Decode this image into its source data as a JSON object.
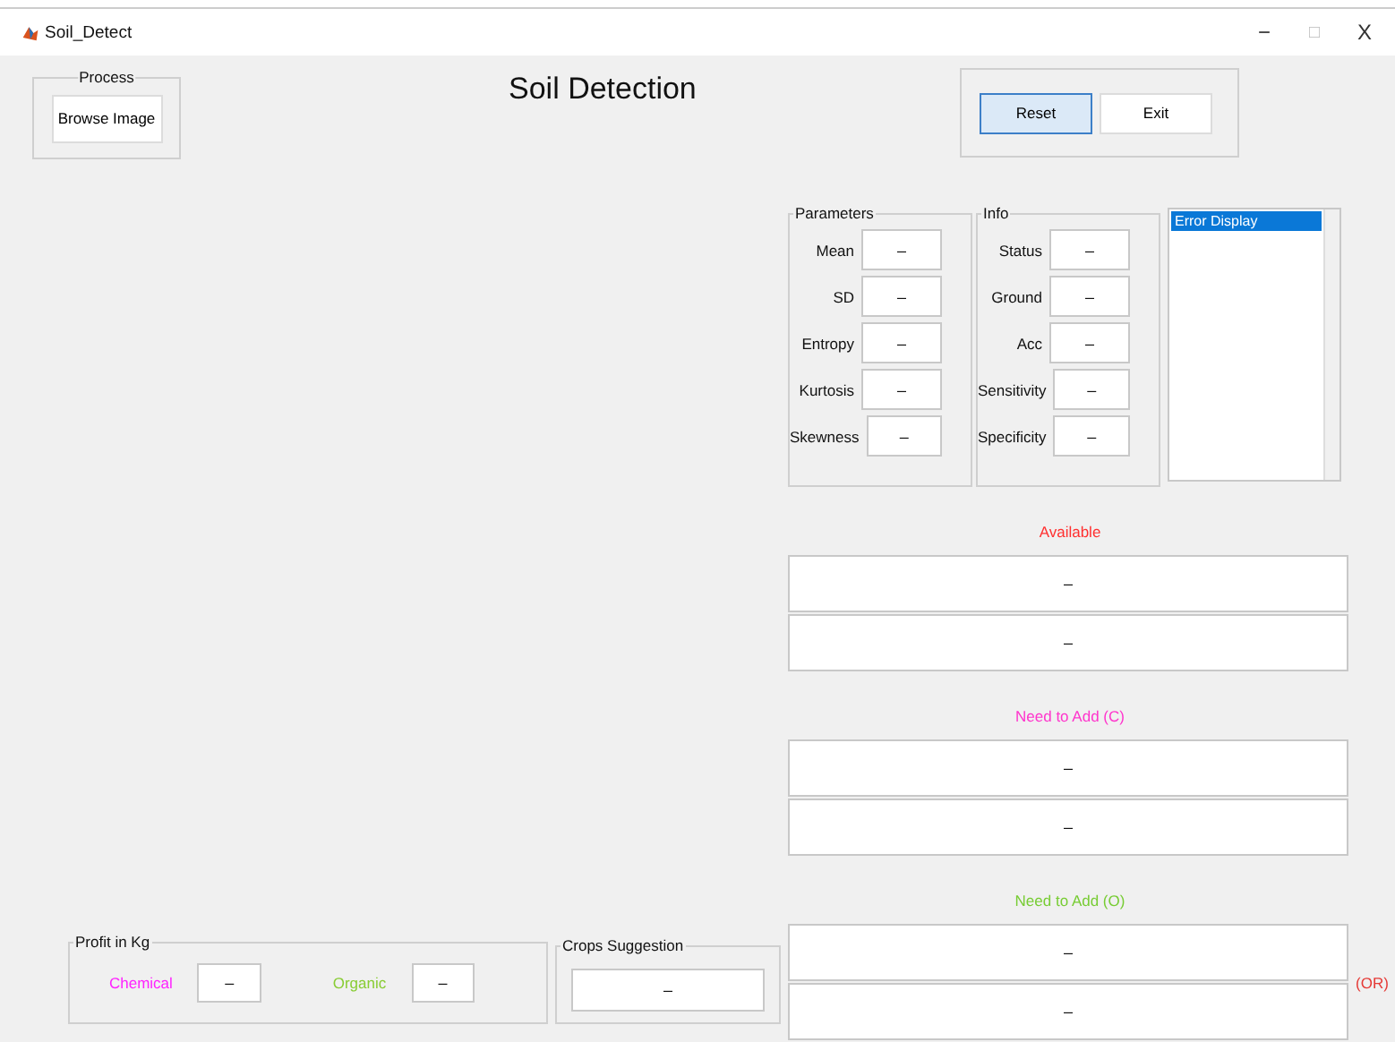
{
  "window": {
    "title": "Soil_Detect",
    "controls": [
      "−",
      "□",
      "X"
    ]
  },
  "process_panel": {
    "title": "Process",
    "button": "Browse Image"
  },
  "heading": "Soil Detection",
  "action_buttons": [
    {
      "label": "Reset",
      "selected": true
    },
    {
      "label": "Exit",
      "selected": false
    }
  ],
  "parameters": {
    "title": "Parameters",
    "fields": [
      {
        "label": "Mean",
        "value": "–"
      },
      {
        "label": "SD",
        "value": "–"
      },
      {
        "label": "Entropy",
        "value": "–"
      },
      {
        "label": "Kurtosis",
        "value": "–"
      },
      {
        "label": "Skewness",
        "value": "–"
      }
    ]
  },
  "info": {
    "title": "Info",
    "fields": [
      {
        "label": "Status",
        "value": "–"
      },
      {
        "label": "Ground",
        "value": "–"
      },
      {
        "label": "Acc",
        "value": "–"
      },
      {
        "label": "Sensitivity",
        "value": "–"
      },
      {
        "label": "Specificity",
        "value": "–"
      }
    ]
  },
  "error_list": {
    "items": [
      {
        "label": "Error Display",
        "selected": true
      }
    ]
  },
  "sections": [
    {
      "label": "Available",
      "color": "#ff3030",
      "values": [
        "–",
        "–"
      ]
    },
    {
      "label": "Need to Add (C)",
      "color": "#ff33cc",
      "values": [
        "–",
        "–"
      ]
    },
    {
      "label": "Need to Add (O)",
      "color": "#77cc33",
      "values": [
        "–",
        "–"
      ],
      "note": "(OR)"
    }
  ],
  "profit_panel": {
    "title": "Profit in Kg",
    "fields": [
      {
        "label": "Chemical",
        "color": "#ff22ff",
        "value": "–"
      },
      {
        "label": "Organic",
        "color": "#88cc33",
        "value": "–"
      }
    ]
  },
  "crops_panel": {
    "title": "Crops Suggestion",
    "value": "–"
  }
}
